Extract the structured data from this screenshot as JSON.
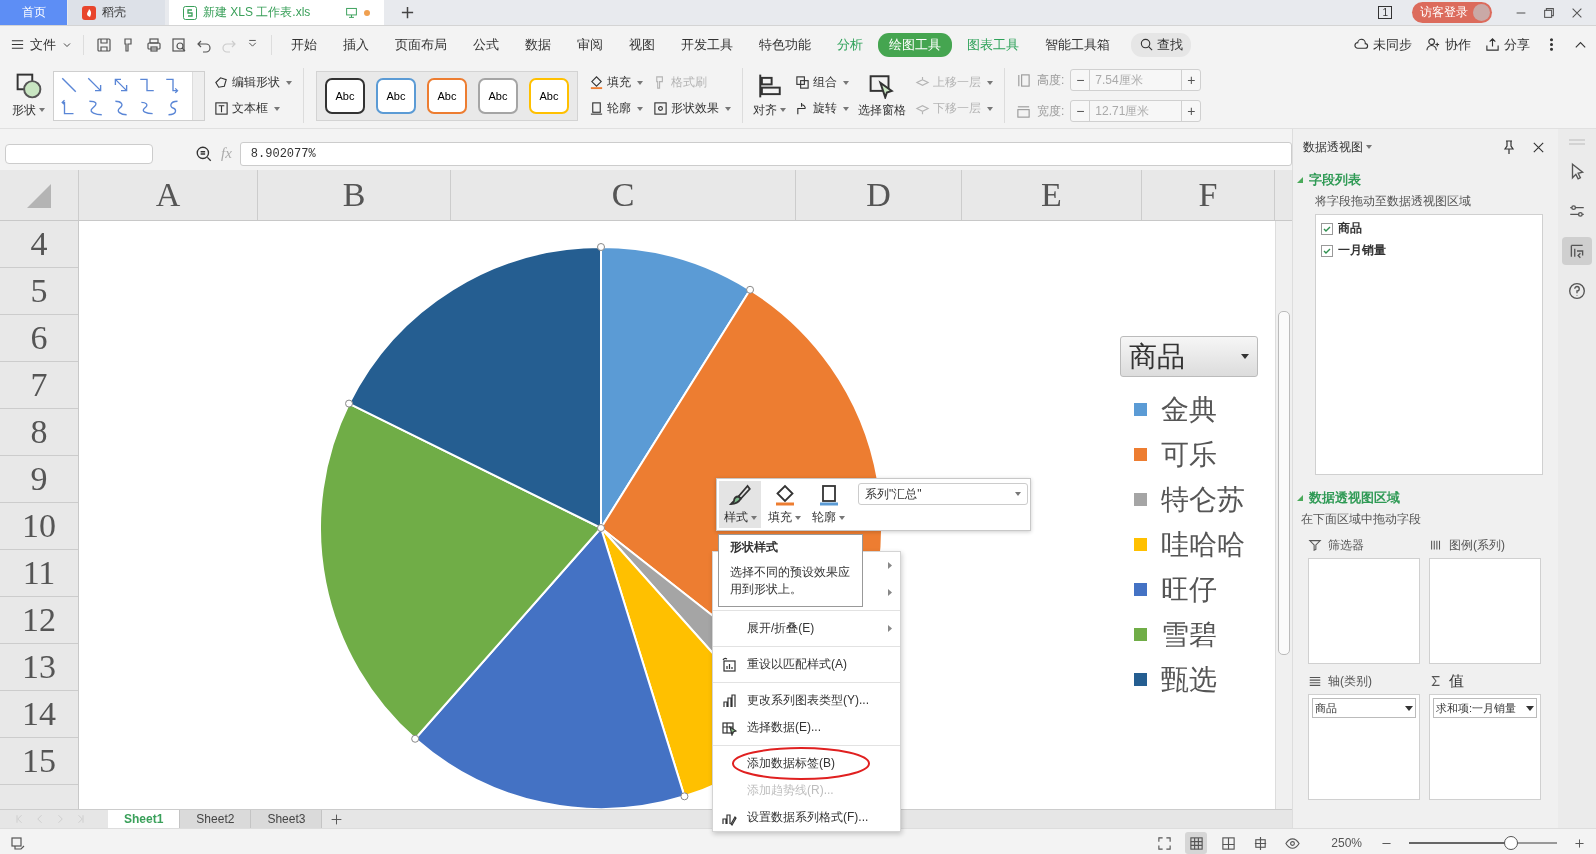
{
  "title_bar": {
    "tabs": [
      {
        "label": "首页",
        "kind": "home",
        "selected": false
      },
      {
        "label": "稻壳",
        "kind": "docer",
        "selected": false
      },
      {
        "label": "新建 XLS 工作表.xls",
        "kind": "doc",
        "selected": true
      }
    ],
    "window_count": "1",
    "login": "访客登录"
  },
  "menu_bar": {
    "file": "文件",
    "tabs": [
      {
        "label": "开始",
        "kind": "plain",
        "selected": false
      },
      {
        "label": "插入",
        "kind": "plain",
        "selected": false
      },
      {
        "label": "页面布局",
        "kind": "plain",
        "selected": false
      },
      {
        "label": "公式",
        "kind": "plain",
        "selected": false
      },
      {
        "label": "数据",
        "kind": "plain",
        "selected": false
      },
      {
        "label": "审阅",
        "kind": "plain",
        "selected": false
      },
      {
        "label": "视图",
        "kind": "plain",
        "selected": false
      },
      {
        "label": "开发工具",
        "kind": "plain",
        "selected": false
      },
      {
        "label": "特色功能",
        "kind": "plain",
        "selected": false
      },
      {
        "label": "分析",
        "kind": "context",
        "selected": false
      },
      {
        "label": "绘图工具",
        "kind": "context",
        "selected": true
      },
      {
        "label": "图表工具",
        "kind": "context",
        "selected": false
      },
      {
        "label": "智能工具箱",
        "kind": "plain",
        "selected": false
      }
    ],
    "search": "查找",
    "actions": [
      "未同步",
      "协作",
      "分享"
    ]
  },
  "ribbon": {
    "shape": "形状",
    "edit_shape": "编辑形状",
    "text_box": "文本框",
    "style_presets": [
      {
        "label": "Abc",
        "color": "#333333"
      },
      {
        "label": "Abc",
        "color": "#5b9bd5"
      },
      {
        "label": "Abc",
        "color": "#ed7d31"
      },
      {
        "label": "Abc",
        "color": "#a5a5a5"
      },
      {
        "label": "Abc",
        "color": "#ffc000"
      }
    ],
    "fill": "填充",
    "outline": "轮廓",
    "format_painter": {
      "label": "格式刷",
      "disabled": true
    },
    "shape_effects": "形状效果",
    "align": "对齐",
    "group": "组合",
    "rotate": "旋转",
    "selection_pane": "选择窗格",
    "bring_forward": {
      "label": "上移一层",
      "disabled": true
    },
    "send_backward": {
      "label": "下移一层",
      "disabled": true
    },
    "size_fields": [
      {
        "label": "高度:",
        "minus": "−",
        "value": "7.54厘米",
        "plus": "+",
        "disabled": true
      },
      {
        "label": "宽度:",
        "minus": "−",
        "value": "12.71厘米",
        "plus": "+",
        "disabled": true
      }
    ]
  },
  "formula_bar": {
    "fx": "fx",
    "value": "8.902077%"
  },
  "columns": [
    "A",
    "B",
    "C",
    "D",
    "E",
    "F"
  ],
  "rows": [
    "4",
    "5",
    "6",
    "7",
    "8",
    "9",
    "10",
    "11",
    "12",
    "13",
    "14",
    "15"
  ],
  "chart": {
    "legend_title": "商品",
    "legend": [
      {
        "label": "金典",
        "color": "#5b9bd5"
      },
      {
        "label": "可乐",
        "color": "#ed7d31"
      },
      {
        "label": "特仑苏",
        "color": "#a5a5a5"
      },
      {
        "label": "哇哈哈",
        "color": "#ffc000"
      },
      {
        "label": "旺仔",
        "color": "#4472c4"
      },
      {
        "label": "雪碧",
        "color": "#70ad47"
      },
      {
        "label": "甄选",
        "color": "#255e91"
      }
    ]
  },
  "mini_toolbar": {
    "buttons": [
      {
        "label": "样式",
        "kind": "style",
        "selected": true
      },
      {
        "label": "填充",
        "kind": "fill",
        "selected": false
      },
      {
        "label": "轮廓",
        "kind": "outline",
        "selected": false
      }
    ],
    "series": "系列\"汇总\""
  },
  "tooltip": {
    "title": "形状样式",
    "text": "选择不同的预设效果应用到形状上。"
  },
  "context_menu": [
    {
      "kind": "plain",
      "submenu": true
    },
    {
      "kind": "plain",
      "submenu": true
    },
    {
      "kind": "plain",
      "label": "展开/折叠(E)",
      "submenu": true,
      "divider": true,
      "disabled": false
    },
    {
      "kind": "reset",
      "label": "重设以匹配样式(A)",
      "divider": true,
      "disabled": false
    },
    {
      "kind": "chart",
      "label": "更改系列图表类型(Y)...",
      "divider": true,
      "disabled": false
    },
    {
      "kind": "select",
      "label": "选择数据(E)...",
      "disabled": false
    },
    {
      "kind": "plain",
      "label": "添加数据标签(B)",
      "divider": true,
      "circled": true,
      "disabled": false
    },
    {
      "kind": "plain",
      "label": "添加趋势线(R)...",
      "disabled": true
    },
    {
      "kind": "format",
      "label": "设置数据系列格式(F)...",
      "disabled": false
    }
  ],
  "sheet_tabs": [
    {
      "label": "Sheet1",
      "selected": true
    },
    {
      "label": "Sheet2",
      "selected": false
    },
    {
      "label": "Sheet3",
      "selected": false
    }
  ],
  "pivot_panel": {
    "title": "数据透视图",
    "field_section": "字段列表",
    "field_hint": "将字段拖动至数据透视图区域",
    "fields": [
      {
        "label": "商品",
        "checked": true
      },
      {
        "label": "一月销量",
        "checked": true
      }
    ],
    "area_section": "数据透视图区域",
    "area_hint": "在下面区域中拖动字段",
    "areas": [
      {
        "label": "筛选器",
        "kind": "filter"
      },
      {
        "label": "图例(系列)",
        "kind": "legend"
      },
      {
        "label": "轴(类别)",
        "kind": "axis",
        "value": "商品"
      },
      {
        "label": "值",
        "kind": "values",
        "value": "求和项:一月销量"
      }
    ]
  },
  "side_tools": [
    {
      "kind": "pointer",
      "selected": false
    },
    {
      "kind": "settings",
      "selected": false
    },
    {
      "kind": "pivot",
      "selected": true
    },
    {
      "kind": "help",
      "selected": false
    }
  ],
  "status_bar": {
    "views": [
      {
        "kind": "fullscreen",
        "selected": false
      },
      {
        "kind": "normal",
        "selected": true
      },
      {
        "kind": "page",
        "selected": false
      },
      {
        "kind": "split",
        "selected": false
      },
      {
        "kind": "eye",
        "selected": false
      }
    ],
    "zoom": "250%",
    "level": 0.69
  }
}
